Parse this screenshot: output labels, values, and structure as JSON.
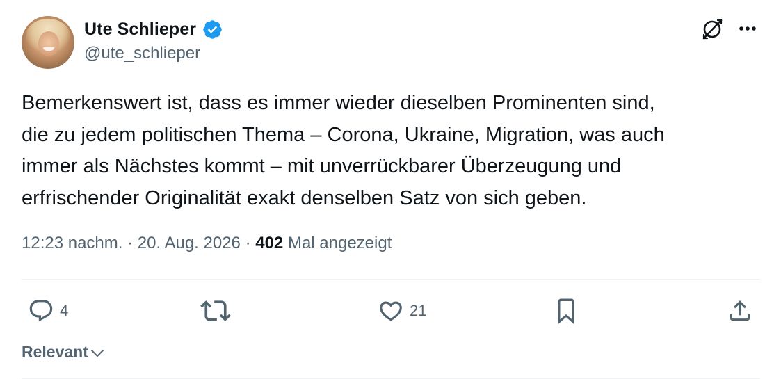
{
  "author": {
    "display_name": "Ute Schlieper",
    "handle": "@ute_schlieper",
    "verified": true
  },
  "tweet": {
    "text": "Bemerkenswert ist, dass es immer wieder dieselben Prominenten sind,\ndie zu jedem politischen Thema – Corona, Ukraine, Migration, was auch\nimmer als Nächstes kommt – mit unverrückbarer Überzeugung und\nerfrischender Originalität exakt denselben Satz von sich geben.",
    "time": "12:23 nachm.",
    "separator": " · ",
    "date": "20. Aug. 2026",
    "views_count": "402",
    "views_label": " Mal angezeigt"
  },
  "actions": {
    "reply_count": "4",
    "repost_count": "",
    "like_count": "21"
  },
  "sort": {
    "label": "Relevant"
  },
  "icons": {
    "verified": "verified-badge-icon",
    "grok": "grok-icon",
    "more": "more-icon",
    "reply": "reply-icon",
    "repost": "repost-icon",
    "like": "heart-icon",
    "bookmark": "bookmark-icon",
    "share": "share-icon",
    "sort": "chevron-down-icon"
  },
  "colors": {
    "text": "#0f1419",
    "secondary": "#536471",
    "verified": "#1d9bf0",
    "divider": "#eff3f4"
  }
}
